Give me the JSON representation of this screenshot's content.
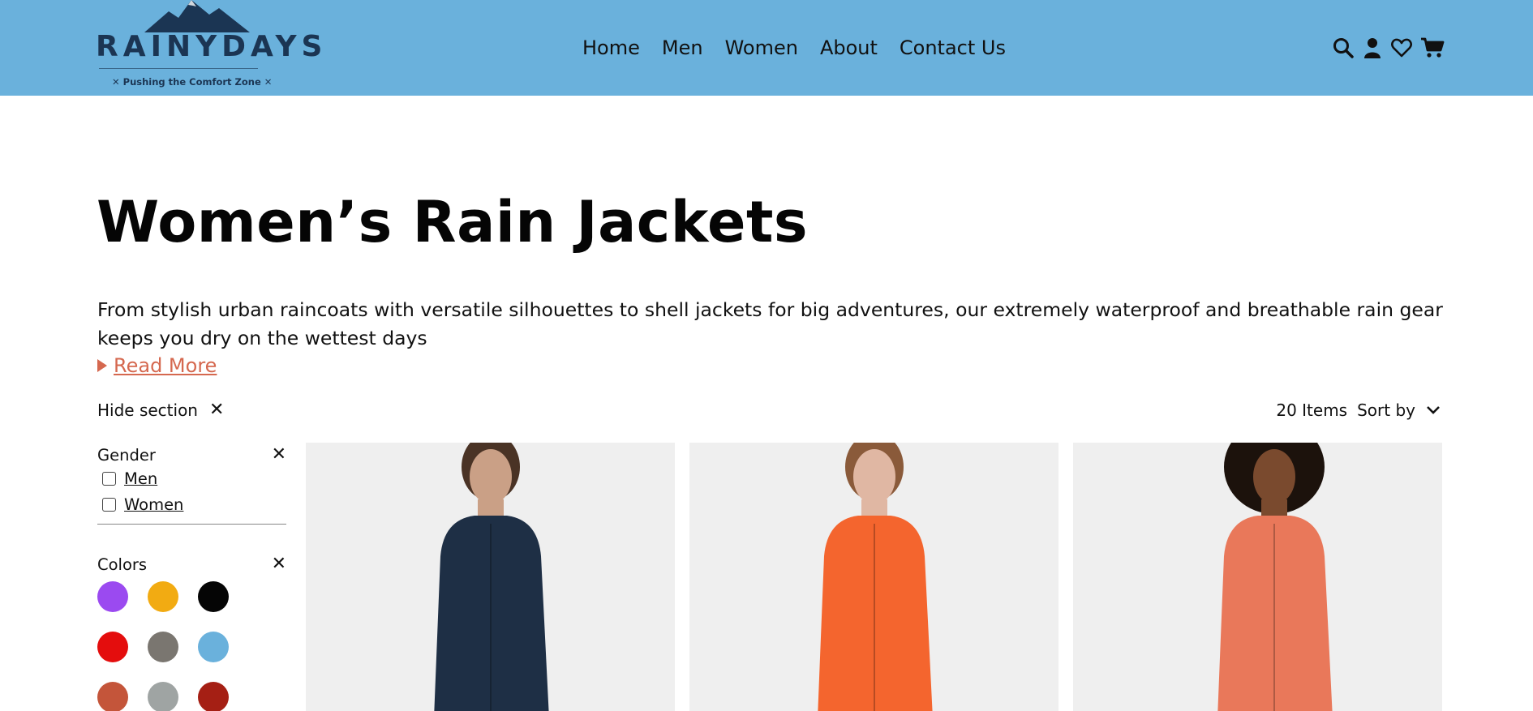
{
  "brand": {
    "name": "RAINYDAYS",
    "tagline": "✕ Pushing the Comfort Zone ✕"
  },
  "nav": {
    "items": [
      "Home",
      "Men",
      "Women",
      "About",
      "Contact Us"
    ]
  },
  "header_icons": [
    "search-icon",
    "user-icon",
    "heart-icon",
    "cart-icon"
  ],
  "page": {
    "title": "Women’s Rain Jackets",
    "description": "From stylish urban raincoats with versatile silhouettes to shell jackets for big adventures, our extremely waterproof and breathable rain gear keeps you dry on the wettest days",
    "read_more": "Read More"
  },
  "controls": {
    "hide_section": "Hide section",
    "items_count": "20 Items",
    "sort_by": "Sort by"
  },
  "filters": {
    "gender": {
      "label": "Gender",
      "options": [
        "Men",
        "Women"
      ]
    },
    "colors": {
      "label": "Colors",
      "swatches": [
        "#9b4af0",
        "#f2ab12",
        "#050505",
        "#e40d0d",
        "#7a7670",
        "#6ab1dc",
        "#c4553a",
        "#9fa4a3",
        "#a51f14"
      ]
    }
  },
  "products": [
    {
      "jacket_color": "#1e2f45",
      "skin": "#caa086",
      "hair": "#4a3325"
    },
    {
      "jacket_color": "#f4652e",
      "skin": "#e0b7a3",
      "hair": "#8a5a3a"
    },
    {
      "jacket_color": "#e9785a",
      "skin": "#7a4a2e",
      "hair": "#1c120c"
    }
  ],
  "colors": {
    "header_bg": "#6ab1dc",
    "accent_link": "#d5684f",
    "product_bg": "#efefef"
  }
}
